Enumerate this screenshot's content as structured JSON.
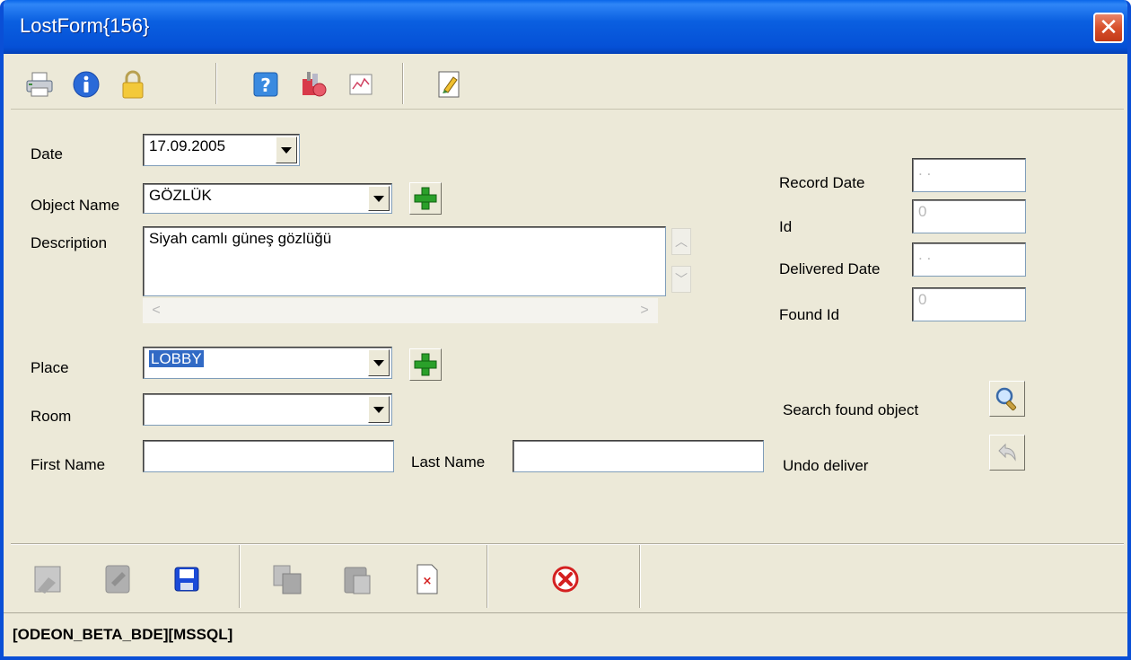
{
  "window": {
    "title": "LostForm{156}"
  },
  "toolbar": {
    "icons": [
      "printer-icon",
      "info-icon",
      "lock-icon",
      "help-icon",
      "tools-icon",
      "chart-icon",
      "edit-document-icon"
    ]
  },
  "form": {
    "date_label": "Date",
    "date_value": "17.09.2005",
    "object_name_label": "Object Name",
    "object_name_value": "GÖZLÜK",
    "description_label": "Description",
    "description_value": "Siyah camlı güneş gözlüğü",
    "place_label": "Place",
    "place_value": "LOBBY",
    "room_label": "Room",
    "room_value": "",
    "first_name_label": "First Name",
    "first_name_value": "",
    "last_name_label": "Last Name",
    "last_name_value": ""
  },
  "side": {
    "record_date_label": "Record Date",
    "record_date_value": ". .",
    "id_label": "Id",
    "id_value": "0",
    "delivered_date_label": "Delivered Date",
    "delivered_date_value": ". .",
    "found_id_label": "Found Id",
    "found_id_value": "0",
    "search_found_label": "Search found object",
    "undo_deliver_label": "Undo deliver"
  },
  "bottom_toolbar": {
    "icons": [
      "new-record-icon",
      "edit-record-icon",
      "save-icon",
      "copy-icon",
      "paste-icon",
      "delete-icon",
      "cancel-icon"
    ]
  },
  "status": {
    "text": "[ODEON_BETA_BDE][MSSQL]"
  },
  "colors": {
    "title_bar": "#0550d6",
    "window_bg": "#ece9d8",
    "selection": "#316ac5",
    "plus_green": "#2aa02a",
    "cancel_red": "#d42020"
  }
}
